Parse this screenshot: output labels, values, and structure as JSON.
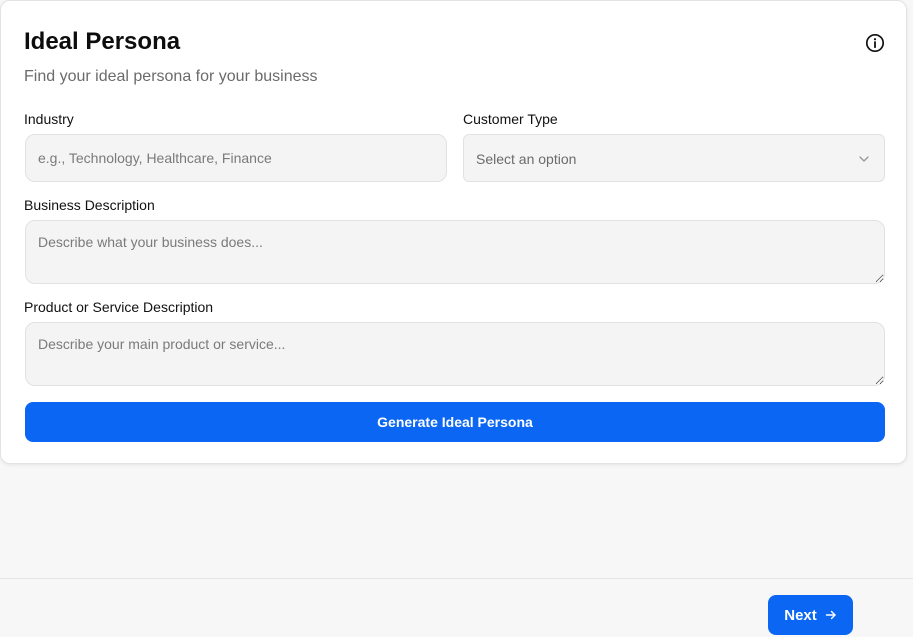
{
  "card": {
    "title": "Ideal Persona",
    "subtitle": "Find your ideal persona for your business",
    "info_icon": "info-circle-icon"
  },
  "form": {
    "industry": {
      "label": "Industry",
      "placeholder": "e.g., Technology, Healthcare, Finance",
      "value": ""
    },
    "customer_type": {
      "label": "Customer Type",
      "selected": "Select an option",
      "icon": "chevron-down-icon"
    },
    "business_description": {
      "label": "Business Description",
      "placeholder": "Describe what your business does...",
      "value": ""
    },
    "product_description": {
      "label": "Product or Service Description",
      "placeholder": "Describe your main product or service...",
      "value": ""
    },
    "generate_label": "Generate Ideal Persona"
  },
  "footer": {
    "next_label": "Next",
    "next_icon": "arrow-right-icon"
  },
  "colors": {
    "primary": "#0a66f3",
    "field_bg": "#f4f4f4",
    "page_bg": "#f7f7f7"
  }
}
